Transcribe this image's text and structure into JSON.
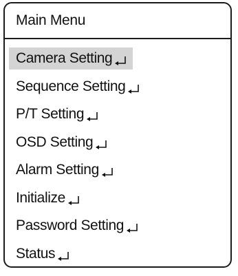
{
  "header": {
    "title": "Main Menu"
  },
  "menu": {
    "selected_index": 0,
    "items": [
      {
        "label": "Camera Setting",
        "icon": "enter-arrow-icon"
      },
      {
        "label": "Sequence Setting",
        "icon": "enter-arrow-icon"
      },
      {
        "label": "P/T Setting",
        "icon": "enter-arrow-icon"
      },
      {
        "label": "OSD Setting",
        "icon": "enter-arrow-icon"
      },
      {
        "label": "Alarm Setting",
        "icon": "enter-arrow-icon"
      },
      {
        "label": "Initialize",
        "icon": "enter-arrow-icon"
      },
      {
        "label": "Password Setting",
        "icon": "enter-arrow-icon"
      },
      {
        "label": "Status",
        "icon": "enter-arrow-icon"
      }
    ]
  },
  "colors": {
    "border": "#1a1a1a",
    "highlight": "#d4d4d4",
    "text": "#111111",
    "background": "#ffffff"
  }
}
